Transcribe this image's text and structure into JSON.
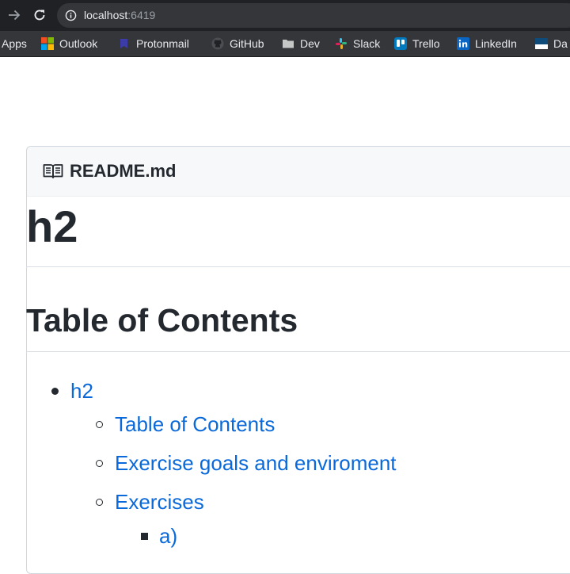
{
  "browser": {
    "url_host": "localhost",
    "url_port": ":6419"
  },
  "bookmarks": [
    {
      "label": "Apps",
      "icon": "apps-grid-icon"
    },
    {
      "label": "Outlook",
      "icon": "outlook-icon"
    },
    {
      "label": "Protonmail",
      "icon": "protonmail-icon"
    },
    {
      "label": "GitHub",
      "icon": "github-icon"
    },
    {
      "label": "Dev",
      "icon": "folder-icon"
    },
    {
      "label": "Slack",
      "icon": "slack-icon"
    },
    {
      "label": "Trello",
      "icon": "trello-icon"
    },
    {
      "label": "LinkedIn",
      "icon": "linkedin-icon"
    },
    {
      "label": "Da",
      "icon": "bookmark-icon"
    }
  ],
  "readme": {
    "file_name": "README.md",
    "h1": "h2",
    "toc_heading": "Table of Contents",
    "toc": [
      {
        "label": "h2",
        "level": 1
      },
      {
        "label": "Table of Contents",
        "level": 2
      },
      {
        "label": "Exercise goals and enviroment",
        "level": 2
      },
      {
        "label": "Exercises",
        "level": 2
      },
      {
        "label": "a)",
        "level": 3
      }
    ]
  },
  "colors": {
    "link": "#0969da",
    "text": "#24292f",
    "chrome_dark": "#202124",
    "chrome_bar": "#35363a"
  }
}
